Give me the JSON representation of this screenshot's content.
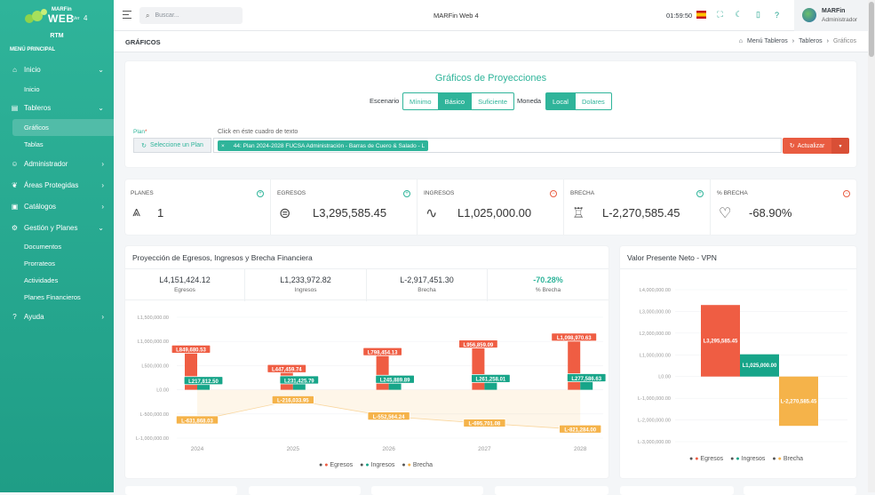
{
  "app": {
    "logo_top": "MARFin",
    "logo_main": "WEB",
    "logo_sub": "Ver",
    "logo_ver": "4",
    "org": "RTM",
    "title": "MARFin Web 4",
    "clock": "01:59:50",
    "user_name": "MARFin",
    "user_role": "Administrador",
    "search_placeholder": "Buscar..."
  },
  "sidebar": {
    "menu_title": "MENÚ PRINCIPAL",
    "items": [
      {
        "label": "Inicio",
        "icon": "home-icon",
        "chev": "⌄"
      },
      {
        "label": "Inicio"
      },
      {
        "label": "Tableros",
        "icon": "chart-icon",
        "chev": "⌄"
      },
      {
        "label": "Gráficos"
      },
      {
        "label": "Tablas"
      },
      {
        "label": "Administrador",
        "icon": "users-icon",
        "chev": "›"
      },
      {
        "label": "Áreas Protegidas",
        "icon": "leaf-icon",
        "chev": "›"
      },
      {
        "label": "Catálogos",
        "icon": "book-icon",
        "chev": "›"
      },
      {
        "label": "Gestión y Planes",
        "icon": "gear-icon",
        "chev": "⌄"
      },
      {
        "label": "Documentos"
      },
      {
        "label": "Prorrateos"
      },
      {
        "label": "Actividades"
      },
      {
        "label": "Planes Financieros"
      },
      {
        "label": "Ayuda",
        "icon": "help-icon",
        "chev": "›"
      }
    ]
  },
  "page": {
    "title": "GRÁFICOS",
    "breadcrumb": [
      "Menú Tableros",
      "Tableros",
      "Gráficos"
    ]
  },
  "filters": {
    "title": "Gráficos de Proyecciones",
    "escenario_label": "Escenario",
    "escenarios": [
      "Mínimo",
      "Básico",
      "Suficiente"
    ],
    "escenario_selected": "Básico",
    "moneda_label": "Moneda",
    "monedas": [
      "Local",
      "Dolares"
    ],
    "moneda_selected": "Local",
    "plan_label": "Plan",
    "plan_required": "*",
    "plan_hint": "Click en éste cuadro de texto",
    "plan_button": "Seleccione un Plan",
    "plan_tag": "44: Plan 2024-2028 FUCSA Administración - Barras de Cuero & Salado - L",
    "plan_tag_remove": "×",
    "update_button": "Actualizar",
    "update_dropdown": "▾"
  },
  "kpis": [
    {
      "label": "PLANES",
      "value": "1",
      "icon": "trees-icon",
      "badge": "+",
      "badge_color": "#2fb49a"
    },
    {
      "label": "EGRESOS",
      "value": "L3,295,585.45",
      "icon": "coins-icon",
      "badge": "+",
      "badge_color": "#2fb49a"
    },
    {
      "label": "INGRESOS",
      "value": "L1,025,000.00",
      "icon": "pulse-icon",
      "badge": "−",
      "badge_color": "#e95c41"
    },
    {
      "label": "BRECHA",
      "value": "L-2,270,585.45",
      "icon": "trophy-icon",
      "badge": "+",
      "badge_color": "#2fb49a"
    },
    {
      "label": "% BRECHA",
      "value": "-68.90%",
      "icon": "heart-icon",
      "badge": "−",
      "badge_color": "#e95c41"
    }
  ],
  "projection": {
    "title": "Proyección de Egresos, Ingresos y Brecha Financiera",
    "summary": [
      {
        "value": "L4,151,424.12",
        "label": "Egresos"
      },
      {
        "value": "L1,233,972.82",
        "label": "Ingresos"
      },
      {
        "value": "L-2,917,451.30",
        "label": "Brecha"
      },
      {
        "value": "-70.28%",
        "label": "% Brecha"
      }
    ]
  },
  "vpn": {
    "title": "Valor Presente Neto - VPN"
  },
  "colors": {
    "accent": "#2fb49a",
    "egresos": "#ef5d43",
    "ingresos": "#17a589",
    "brecha": "#f5b34a"
  },
  "chart_data": [
    {
      "type": "bar",
      "categories": [
        "2024",
        "2025",
        "2026",
        "2027",
        "2028"
      ],
      "series": [
        {
          "name": "Egresos",
          "values": [
            849680.53,
            447459.74,
            798454.13,
            956859.09,
            1098970.63
          ],
          "labels": [
            "L849,680.53",
            "L447,459.74",
            "L798,454.13",
            "L956,859.09",
            "L1,098,970.63"
          ]
        },
        {
          "name": "Ingresos",
          "values": [
            217812.5,
            231425.79,
            245889.89,
            261258.01,
            277586.63
          ],
          "labels": [
            "L217,812.50",
            "L231,425.79",
            "L245,889.89",
            "L261,258.01",
            "L277,586.63"
          ]
        },
        {
          "name": "Brecha",
          "values": [
            -631868.03,
            -216033.95,
            -552564.24,
            -695701.08,
            -821284.0
          ],
          "labels": [
            "L-631,868.03",
            "L-216,033.95",
            "L-552,564.24",
            "L-695,701.08",
            "L-821,284.00"
          ]
        }
      ],
      "ylim": [
        -1000000,
        1500000
      ],
      "yticks": [
        1500000,
        1000000,
        500000,
        0,
        -500000,
        -1000000
      ],
      "ytick_labels": [
        "L1,500,000.00",
        "L1,000,000.00",
        "L500,000.00",
        "L0.00",
        "L-500,000.00",
        "L-1,000,000.00"
      ],
      "legend": "bottom"
    },
    {
      "type": "bar",
      "categories": [
        "Egresos",
        "Ingresos",
        "Brecha"
      ],
      "values": [
        3295585.45,
        1025000.0,
        -2270585.45
      ],
      "labels": [
        "L3,295,585.45",
        "L1,025,000.00",
        "L-2,270,585.45"
      ],
      "ylim": [
        -3000000,
        4000000
      ],
      "yticks": [
        4000000,
        3000000,
        2000000,
        1000000,
        0,
        -1000000,
        -2000000,
        -3000000
      ],
      "ytick_labels": [
        "L4,000,000.00",
        "L3,000,000.00",
        "L2,000,000.00",
        "L1,000,000.00",
        "L0.00",
        "L-1,000,000.00",
        "L-2,000,000.00",
        "L-3,000,000.00"
      ],
      "legend": "bottom"
    }
  ]
}
